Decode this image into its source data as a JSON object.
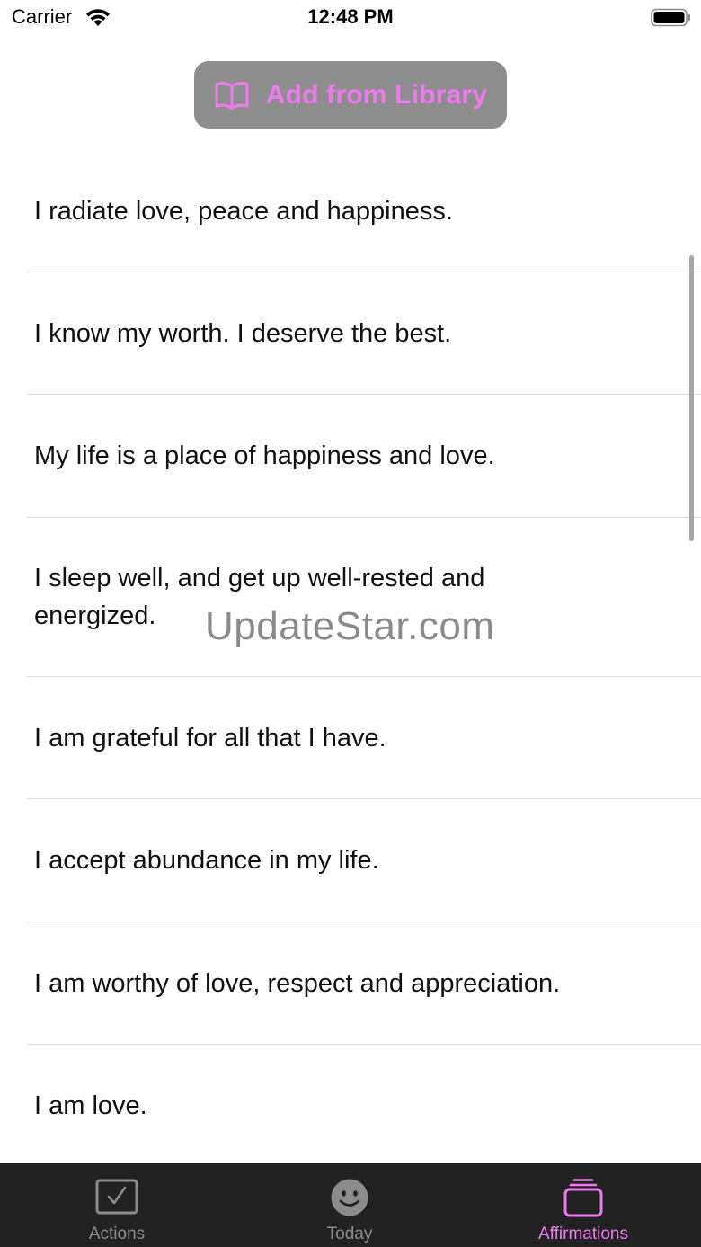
{
  "status_bar": {
    "carrier": "Carrier",
    "time": "12:48 PM"
  },
  "library_button": {
    "label": "Add from Library",
    "icon": "book-icon"
  },
  "affirmations": [
    "I radiate love, peace and happiness.",
    "I know my worth. I deserve the best.",
    "My life is a place of happiness and love.",
    "I sleep well, and get up well-rested and energized.",
    "I am grateful for all that I have.",
    "I accept abundance in my life.",
    "I am worthy of love, respect and appreciation.",
    "I am love."
  ],
  "watermark": "UpdateStar.com",
  "tabs": [
    {
      "label": "Actions",
      "icon": "checkbox-icon",
      "selected": false
    },
    {
      "label": "Today",
      "icon": "smiley-icon",
      "selected": false
    },
    {
      "label": "Affirmations",
      "icon": "stack-icon",
      "selected": true
    }
  ],
  "colors": {
    "accent": "#ee7af0",
    "tab_inactive": "#8c8c8c",
    "tab_bar_bg": "#222222",
    "button_bg": "#8e8e8e"
  }
}
